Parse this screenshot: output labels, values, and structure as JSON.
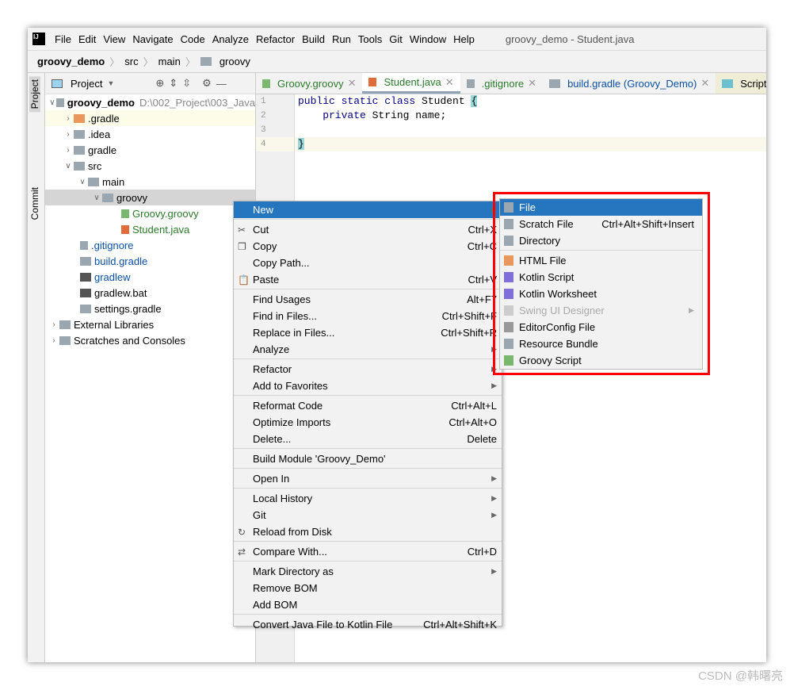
{
  "menubar": {
    "items": [
      "File",
      "Edit",
      "View",
      "Navigate",
      "Code",
      "Analyze",
      "Refactor",
      "Build",
      "Run",
      "Tools",
      "Git",
      "Window",
      "Help"
    ],
    "title": "groovy_demo - Student.java"
  },
  "breadcrumb": [
    "groovy_demo",
    "src",
    "main",
    "groovy"
  ],
  "side_strip": {
    "project": "Project",
    "commit": "Commit"
  },
  "project_panel": {
    "title": "Project",
    "root": "groovy_demo",
    "root_path": "D:\\002_Project\\003_Java"
  },
  "tree": [
    ".gradle",
    ".idea",
    "gradle",
    "src",
    "main",
    "groovy",
    "Groovy.groovy",
    "Student.java",
    ".gitignore",
    "build.gradle",
    "gradlew",
    "gradlew.bat",
    "settings.gradle",
    "External Libraries",
    "Scratches and Consoles"
  ],
  "tabs": [
    "Groovy.groovy",
    "Student.java",
    ".gitignore",
    "build.gradle (Groovy_Demo)",
    "Script.java"
  ],
  "code": {
    "lines": [
      "1",
      "2",
      "3",
      "4"
    ],
    "l1a": "public static class",
    "l1b": " Student ",
    "l1c": "{",
    "l2a": "    private",
    " l2b": "",
    "l2c": " String name;",
    "l4": "}"
  },
  "context_menu": [
    {
      "label": "New",
      "shortcut": ""
    },
    {
      "label": "Cut",
      "shortcut": "Ctrl+X"
    },
    {
      "label": "Copy",
      "shortcut": "Ctrl+C"
    },
    {
      "label": "Copy Path...",
      "shortcut": ""
    },
    {
      "label": "Paste",
      "shortcut": "Ctrl+V"
    },
    {
      "label": "Find Usages",
      "shortcut": "Alt+F7"
    },
    {
      "label": "Find in Files...",
      "shortcut": "Ctrl+Shift+F"
    },
    {
      "label": "Replace in Files...",
      "shortcut": "Ctrl+Shift+R"
    },
    {
      "label": "Analyze",
      "shortcut": ""
    },
    {
      "label": "Refactor",
      "shortcut": ""
    },
    {
      "label": "Add to Favorites",
      "shortcut": ""
    },
    {
      "label": "Reformat Code",
      "shortcut": "Ctrl+Alt+L"
    },
    {
      "label": "Optimize Imports",
      "shortcut": "Ctrl+Alt+O"
    },
    {
      "label": "Delete...",
      "shortcut": "Delete"
    },
    {
      "label": "Build Module 'Groovy_Demo'",
      "shortcut": ""
    },
    {
      "label": "Open In",
      "shortcut": ""
    },
    {
      "label": "Local History",
      "shortcut": ""
    },
    {
      "label": "Git",
      "shortcut": ""
    },
    {
      "label": "Reload from Disk",
      "shortcut": ""
    },
    {
      "label": "Compare With...",
      "shortcut": "Ctrl+D"
    },
    {
      "label": "Mark Directory as",
      "shortcut": ""
    },
    {
      "label": "Remove BOM",
      "shortcut": ""
    },
    {
      "label": "Add BOM",
      "shortcut": ""
    },
    {
      "label": "Convert Java File to Kotlin File",
      "shortcut": "Ctrl+Alt+Shift+K"
    }
  ],
  "submenu": [
    {
      "label": "File",
      "shortcut": ""
    },
    {
      "label": "Scratch File",
      "shortcut": "Ctrl+Alt+Shift+Insert"
    },
    {
      "label": "Directory",
      "shortcut": ""
    },
    {
      "label": "HTML File",
      "shortcut": ""
    },
    {
      "label": "Kotlin Script",
      "shortcut": ""
    },
    {
      "label": "Kotlin Worksheet",
      "shortcut": ""
    },
    {
      "label": "Swing UI Designer",
      "shortcut": ""
    },
    {
      "label": "EditorConfig File",
      "shortcut": ""
    },
    {
      "label": "Resource Bundle",
      "shortcut": ""
    },
    {
      "label": "Groovy Script",
      "shortcut": ""
    }
  ],
  "watermark": "CSDN @韩曙亮",
  "colors": {
    "selection": "#2675bf",
    "highlight_border": "#ff0000"
  }
}
